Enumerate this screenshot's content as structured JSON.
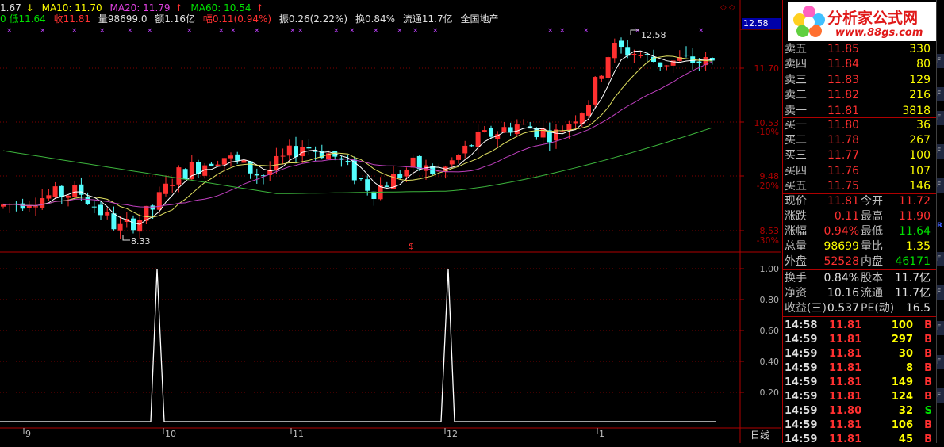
{
  "info_line1": {
    "ma5": "1.67",
    "ma10": "MA10: 11.70",
    "ma20": "MA20: 11.79",
    "ma60": "MA60: 10.54"
  },
  "info_line2": {
    "low": "0 低11.64",
    "close": "收11.81",
    "vol": "量98699.0",
    "amount": "额1.16亿",
    "change": "幅0.11(0.94%)",
    "amplitude": "振0.26(2.22%)",
    "turnover": "换0.84%",
    "float": "流通11.7亿",
    "name": "全国地产"
  },
  "price_tag": "12.58",
  "axis_main": {
    "p1": "11.70",
    "p2": "10.53",
    "p2pct": "-10%",
    "p3": "9.48",
    "p3pct": "-20%",
    "p4": "8.53",
    "p4pct": "-30%"
  },
  "axis_sub": [
    "1.00",
    "0.80",
    "0.60",
    "0.40",
    "0.20"
  ],
  "annotations": {
    "high": "12.58",
    "low": "8.33",
    "marker": "$"
  },
  "x_labels": [
    "9",
    "10",
    "11",
    "12",
    "1"
  ],
  "period": "日线",
  "logo": {
    "brand": "分析家公式网",
    "url": "www.88gs.com"
  },
  "quote": {
    "asks": [
      {
        "label": "卖五",
        "price": "11.85",
        "vol": "330"
      },
      {
        "label": "卖四",
        "price": "11.84",
        "vol": "80"
      },
      {
        "label": "卖三",
        "price": "11.83",
        "vol": "129"
      },
      {
        "label": "卖二",
        "price": "11.82",
        "vol": "216"
      },
      {
        "label": "卖一",
        "price": "11.81",
        "vol": "3818"
      }
    ],
    "bids": [
      {
        "label": "买一",
        "price": "11.80",
        "vol": "36"
      },
      {
        "label": "买二",
        "price": "11.78",
        "vol": "267"
      },
      {
        "label": "买三",
        "price": "11.77",
        "vol": "100"
      },
      {
        "label": "买四",
        "price": "11.76",
        "vol": "107"
      },
      {
        "label": "买五",
        "price": "11.75",
        "vol": "146"
      }
    ],
    "stats": [
      {
        "l1": "现价",
        "v1": "11.81",
        "l2": "今开",
        "v2": "11.72"
      },
      {
        "l1": "涨跌",
        "v1": "0.11",
        "l2": "最高",
        "v2": "11.90"
      },
      {
        "l1": "涨幅",
        "v1": "0.94%",
        "l2": "最低",
        "v2": "11.64"
      },
      {
        "l1": "总量",
        "v1": "98699",
        "l2": "量比",
        "v2": "1.35"
      },
      {
        "l1": "外盘",
        "v1": "52528",
        "l2": "内盘",
        "v2": "46171"
      }
    ],
    "fund": [
      {
        "l1": "换手",
        "v1": "0.84%",
        "l2": "股本",
        "v2": "11.7亿"
      },
      {
        "l1": "净资",
        "v1": "10.16",
        "l2": "流通",
        "v2": "11.7亿"
      },
      {
        "l1": "收益(三)",
        "v1": "0.537",
        "l2": "PE(动)",
        "v2": "16.5"
      }
    ],
    "ticks": [
      {
        "time": "14:58",
        "price": "11.81",
        "vol": "100",
        "side": "B"
      },
      {
        "time": "14:59",
        "price": "11.81",
        "vol": "297",
        "side": "B"
      },
      {
        "time": "14:59",
        "price": "11.81",
        "vol": "30",
        "side": "B"
      },
      {
        "time": "14:59",
        "price": "11.81",
        "vol": "8",
        "side": "B"
      },
      {
        "time": "14:59",
        "price": "11.81",
        "vol": "149",
        "side": "B"
      },
      {
        "time": "14:59",
        "price": "11.81",
        "vol": "124",
        "side": "B"
      },
      {
        "time": "14:59",
        "price": "11.80",
        "vol": "32",
        "side": "S"
      },
      {
        "time": "14:59",
        "price": "11.81",
        "vol": "106",
        "side": "B"
      },
      {
        "time": "14:59",
        "price": "11.81",
        "vol": "45",
        "side": "B"
      }
    ]
  },
  "colors": {
    "up": "#ff3030",
    "down": "#54ffff",
    "ma60": "#3cb43c",
    "ma20": "#c040c0",
    "ma10": "#e0e060",
    "ma5": "#ffffff",
    "grid": "#800000"
  }
}
